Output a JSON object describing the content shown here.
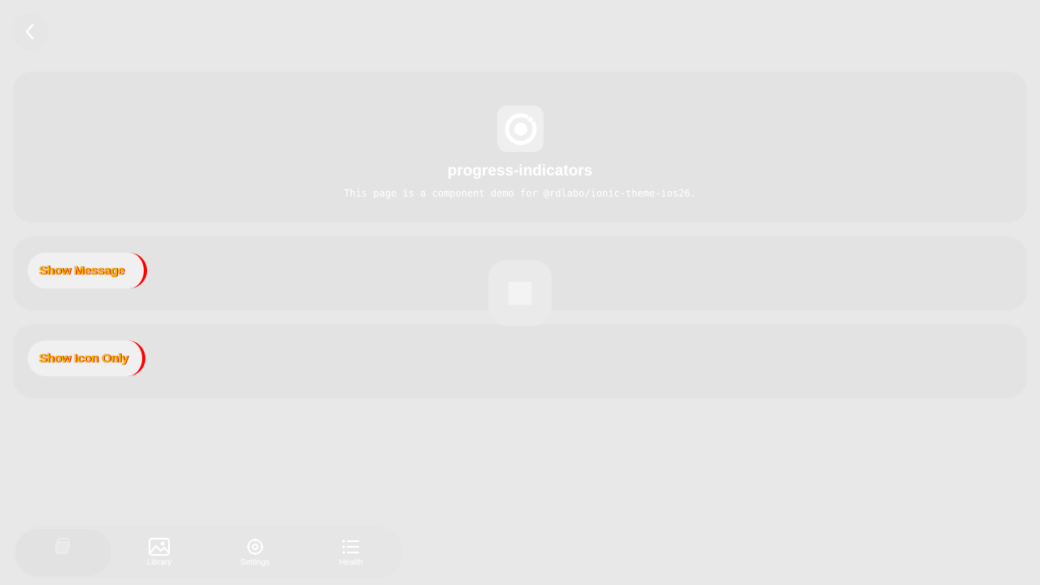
{
  "header": {
    "title": "progress-indicators",
    "subtitle": "This page is a component demo for @rdlabo/ionic-theme-ios26."
  },
  "buttons": {
    "show_message": "Show Message",
    "show_icon_only": "Show Icon Only"
  },
  "tabs": [
    {
      "label": "",
      "icon": "stack-icon",
      "active": true
    },
    {
      "label": "Library",
      "icon": "images-icon",
      "active": false
    },
    {
      "label": "Settings",
      "icon": "gear-icon",
      "active": false
    },
    {
      "label": "Health",
      "icon": "list-icon",
      "active": false
    }
  ],
  "colors": {
    "background": "#e8e8e8",
    "card": "#e3e3e3",
    "button_text": "#f2c200",
    "button_accent": "#ff0000"
  }
}
